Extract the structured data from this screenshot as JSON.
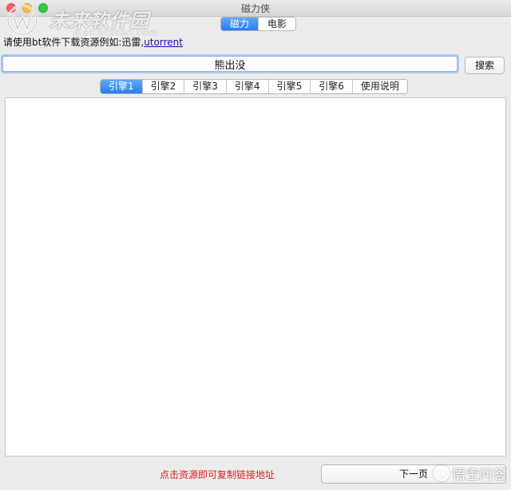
{
  "window": {
    "title": "磁力侠"
  },
  "watermark": {
    "brand": "未来软件园",
    "url": "mac.orsoon.com"
  },
  "mode_tabs": [
    {
      "label": "磁力",
      "active": true
    },
    {
      "label": "电影",
      "active": false
    }
  ],
  "hint": {
    "text": "请使用bt软件下载资源例如:迅雷,",
    "link": "utorrent"
  },
  "search": {
    "value": "熊出没",
    "button_label": "搜索"
  },
  "engine_tabs": [
    {
      "label": "引擎1",
      "active": true
    },
    {
      "label": "引擎2",
      "active": false
    },
    {
      "label": "引擎3",
      "active": false
    },
    {
      "label": "引擎4",
      "active": false
    },
    {
      "label": "引擎5",
      "active": false
    },
    {
      "label": "引擎6",
      "active": false
    },
    {
      "label": "使用说明",
      "active": false
    }
  ],
  "footer": {
    "hint": "点击资源即可复制链接地址",
    "next_label": "下一页"
  },
  "corner_watermark": {
    "text": "悟空问答"
  },
  "colors": {
    "accent": "#2a7df0",
    "footer_hint": "#e0201b",
    "link": "#1a0dab"
  }
}
